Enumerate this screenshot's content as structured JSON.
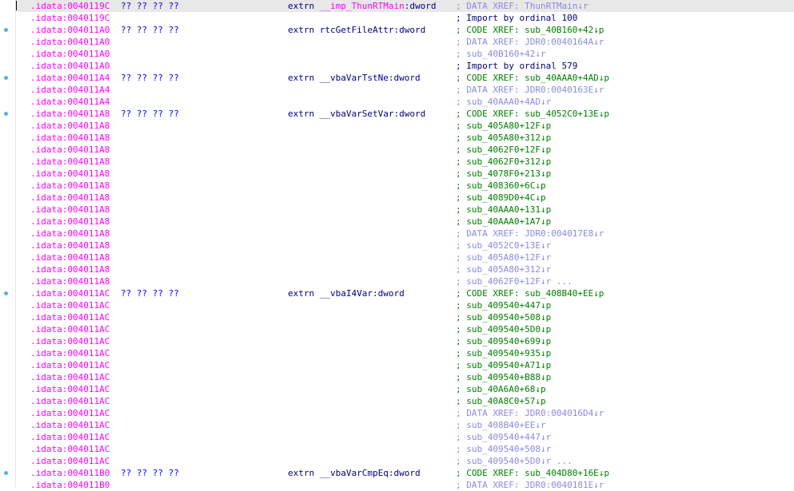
{
  "colors": {
    "address": "#ff00ff",
    "bytes": "#0000ff",
    "declaration": "#000080",
    "code_xref": "#008000",
    "data_xref": "#8a8ae0",
    "bookmark_dot": "#52b2e3",
    "current_line": "#e8e8e8"
  },
  "lines": [
    {
      "addr": ".idata:0040119C",
      "bytes": "?? ?? ?? ??",
      "kw": "extrn ",
      "name": "__imp_ThunRTMain",
      "type": ":dword",
      "comment": "; DATA XREF: ThunRTMain↓r",
      "ctype": "light",
      "dot": false,
      "current": true,
      "imp": true
    },
    {
      "addr": ".idata:0040119C",
      "bytes": "",
      "kw": "",
      "name": "",
      "type": "",
      "comment": "; Import by ordinal 100",
      "ctype": "navy",
      "dot": false
    },
    {
      "addr": ".idata:004011A0",
      "bytes": "?? ?? ?? ??",
      "kw": "extrn ",
      "name": "rtcGetFileAttr",
      "type": ":dword",
      "comment": "; CODE XREF: sub_40B160+42↓p",
      "ctype": "green",
      "dot": true
    },
    {
      "addr": ".idata:004011A0",
      "bytes": "",
      "kw": "",
      "name": "",
      "type": "",
      "comment": "; DATA XREF: JDR0:0040164A↓r",
      "ctype": "light",
      "dot": false
    },
    {
      "addr": ".idata:004011A0",
      "bytes": "",
      "kw": "",
      "name": "",
      "type": "",
      "comment": "; sub_40B160+42↓r",
      "ctype": "light",
      "dot": false
    },
    {
      "addr": ".idata:004011A0",
      "bytes": "",
      "kw": "",
      "name": "",
      "type": "",
      "comment": "; Import by ordinal 579",
      "ctype": "navy",
      "dot": false
    },
    {
      "addr": ".idata:004011A4",
      "bytes": "?? ?? ?? ??",
      "kw": "extrn ",
      "name": "__vbaVarTstNe",
      "type": ":dword",
      "comment": "; CODE XREF: sub_40AAA0+4AD↓p",
      "ctype": "green",
      "dot": true
    },
    {
      "addr": ".idata:004011A4",
      "bytes": "",
      "kw": "",
      "name": "",
      "type": "",
      "comment": "; DATA XREF: JDR0:0040163E↓r",
      "ctype": "light",
      "dot": false
    },
    {
      "addr": ".idata:004011A4",
      "bytes": "",
      "kw": "",
      "name": "",
      "type": "",
      "comment": "; sub_40AAA0+4AD↓r",
      "ctype": "light",
      "dot": false
    },
    {
      "addr": ".idata:004011A8",
      "bytes": "?? ?? ?? ??",
      "kw": "extrn ",
      "name": "__vbaVarSetVar",
      "type": ":dword",
      "comment": "; CODE XREF: sub_4052C0+13E↓p",
      "ctype": "green",
      "dot": true
    },
    {
      "addr": ".idata:004011A8",
      "bytes": "",
      "kw": "",
      "name": "",
      "type": "",
      "comment": "; sub_405A80+12F↓p",
      "ctype": "green",
      "dot": false
    },
    {
      "addr": ".idata:004011A8",
      "bytes": "",
      "kw": "",
      "name": "",
      "type": "",
      "comment": "; sub_405A80+312↓p",
      "ctype": "green",
      "dot": false
    },
    {
      "addr": ".idata:004011A8",
      "bytes": "",
      "kw": "",
      "name": "",
      "type": "",
      "comment": "; sub_4062F0+12F↓p",
      "ctype": "green",
      "dot": false
    },
    {
      "addr": ".idata:004011A8",
      "bytes": "",
      "kw": "",
      "name": "",
      "type": "",
      "comment": "; sub_4062F0+312↓p",
      "ctype": "green",
      "dot": false
    },
    {
      "addr": ".idata:004011A8",
      "bytes": "",
      "kw": "",
      "name": "",
      "type": "",
      "comment": "; sub_4078F0+213↓p",
      "ctype": "green",
      "dot": false
    },
    {
      "addr": ".idata:004011A8",
      "bytes": "",
      "kw": "",
      "name": "",
      "type": "",
      "comment": "; sub_408360+6C↓p",
      "ctype": "green",
      "dot": false
    },
    {
      "addr": ".idata:004011A8",
      "bytes": "",
      "kw": "",
      "name": "",
      "type": "",
      "comment": "; sub_4089D0+4C↓p",
      "ctype": "green",
      "dot": false
    },
    {
      "addr": ".idata:004011A8",
      "bytes": "",
      "kw": "",
      "name": "",
      "type": "",
      "comment": "; sub_40AAA0+131↓p",
      "ctype": "green",
      "dot": false
    },
    {
      "addr": ".idata:004011A8",
      "bytes": "",
      "kw": "",
      "name": "",
      "type": "",
      "comment": "; sub_40AAA0+1A7↓p",
      "ctype": "green",
      "dot": false
    },
    {
      "addr": ".idata:004011A8",
      "bytes": "",
      "kw": "",
      "name": "",
      "type": "",
      "comment": "; DATA XREF: JDR0:004017E8↓r",
      "ctype": "light",
      "dot": false
    },
    {
      "addr": ".idata:004011A8",
      "bytes": "",
      "kw": "",
      "name": "",
      "type": "",
      "comment": "; sub_4052C0+13E↓r",
      "ctype": "light",
      "dot": false
    },
    {
      "addr": ".idata:004011A8",
      "bytes": "",
      "kw": "",
      "name": "",
      "type": "",
      "comment": "; sub_405A80+12F↓r",
      "ctype": "light",
      "dot": false
    },
    {
      "addr": ".idata:004011A8",
      "bytes": "",
      "kw": "",
      "name": "",
      "type": "",
      "comment": "; sub_405A80+312↓r",
      "ctype": "light",
      "dot": false
    },
    {
      "addr": ".idata:004011A8",
      "bytes": "",
      "kw": "",
      "name": "",
      "type": "",
      "comment": "; sub_4062F0+12F↓r ...",
      "ctype": "light",
      "dot": false
    },
    {
      "addr": ".idata:004011AC",
      "bytes": "?? ?? ?? ??",
      "kw": "extrn ",
      "name": "__vbaI4Var",
      "type": ":dword",
      "comment": "; CODE XREF: sub_408B40+EE↓p",
      "ctype": "green",
      "dot": true
    },
    {
      "addr": ".idata:004011AC",
      "bytes": "",
      "kw": "",
      "name": "",
      "type": "",
      "comment": "; sub_409540+447↓p",
      "ctype": "green",
      "dot": false
    },
    {
      "addr": ".idata:004011AC",
      "bytes": "",
      "kw": "",
      "name": "",
      "type": "",
      "comment": "; sub_409540+508↓p",
      "ctype": "green",
      "dot": false
    },
    {
      "addr": ".idata:004011AC",
      "bytes": "",
      "kw": "",
      "name": "",
      "type": "",
      "comment": "; sub_409540+5D0↓p",
      "ctype": "green",
      "dot": false
    },
    {
      "addr": ".idata:004011AC",
      "bytes": "",
      "kw": "",
      "name": "",
      "type": "",
      "comment": "; sub_409540+699↓p",
      "ctype": "green",
      "dot": false
    },
    {
      "addr": ".idata:004011AC",
      "bytes": "",
      "kw": "",
      "name": "",
      "type": "",
      "comment": "; sub_409540+935↓p",
      "ctype": "green",
      "dot": false
    },
    {
      "addr": ".idata:004011AC",
      "bytes": "",
      "kw": "",
      "name": "",
      "type": "",
      "comment": "; sub_409540+A71↓p",
      "ctype": "green",
      "dot": false
    },
    {
      "addr": ".idata:004011AC",
      "bytes": "",
      "kw": "",
      "name": "",
      "type": "",
      "comment": "; sub_409540+B88↓p",
      "ctype": "green",
      "dot": false
    },
    {
      "addr": ".idata:004011AC",
      "bytes": "",
      "kw": "",
      "name": "",
      "type": "",
      "comment": "; sub_40A6A0+68↓p",
      "ctype": "green",
      "dot": false
    },
    {
      "addr": ".idata:004011AC",
      "bytes": "",
      "kw": "",
      "name": "",
      "type": "",
      "comment": "; sub_40A8C0+57↓p",
      "ctype": "green",
      "dot": false
    },
    {
      "addr": ".idata:004011AC",
      "bytes": "",
      "kw": "",
      "name": "",
      "type": "",
      "comment": "; DATA XREF: JDR0:004016D4↓r",
      "ctype": "light",
      "dot": false
    },
    {
      "addr": ".idata:004011AC",
      "bytes": "",
      "kw": "",
      "name": "",
      "type": "",
      "comment": "; sub_408B40+EE↓r",
      "ctype": "light",
      "dot": false
    },
    {
      "addr": ".idata:004011AC",
      "bytes": "",
      "kw": "",
      "name": "",
      "type": "",
      "comment": "; sub_409540+447↓r",
      "ctype": "light",
      "dot": false
    },
    {
      "addr": ".idata:004011AC",
      "bytes": "",
      "kw": "",
      "name": "",
      "type": "",
      "comment": "; sub_409540+508↓r",
      "ctype": "light",
      "dot": false
    },
    {
      "addr": ".idata:004011AC",
      "bytes": "",
      "kw": "",
      "name": "",
      "type": "",
      "comment": "; sub_409540+5D0↓r ...",
      "ctype": "light",
      "dot": false
    },
    {
      "addr": ".idata:004011B0",
      "bytes": "?? ?? ?? ??",
      "kw": "extrn ",
      "name": "__vbaVarCmpEq",
      "type": ":dword",
      "comment": "; CODE XREF: sub_404D80+16E↓p",
      "ctype": "green",
      "dot": true
    },
    {
      "addr": ".idata:004011B0",
      "bytes": "",
      "kw": "",
      "name": "",
      "type": "",
      "comment": "; DATA XREF: JDR0:0040181E↓r",
      "ctype": "light",
      "dot": false
    }
  ]
}
